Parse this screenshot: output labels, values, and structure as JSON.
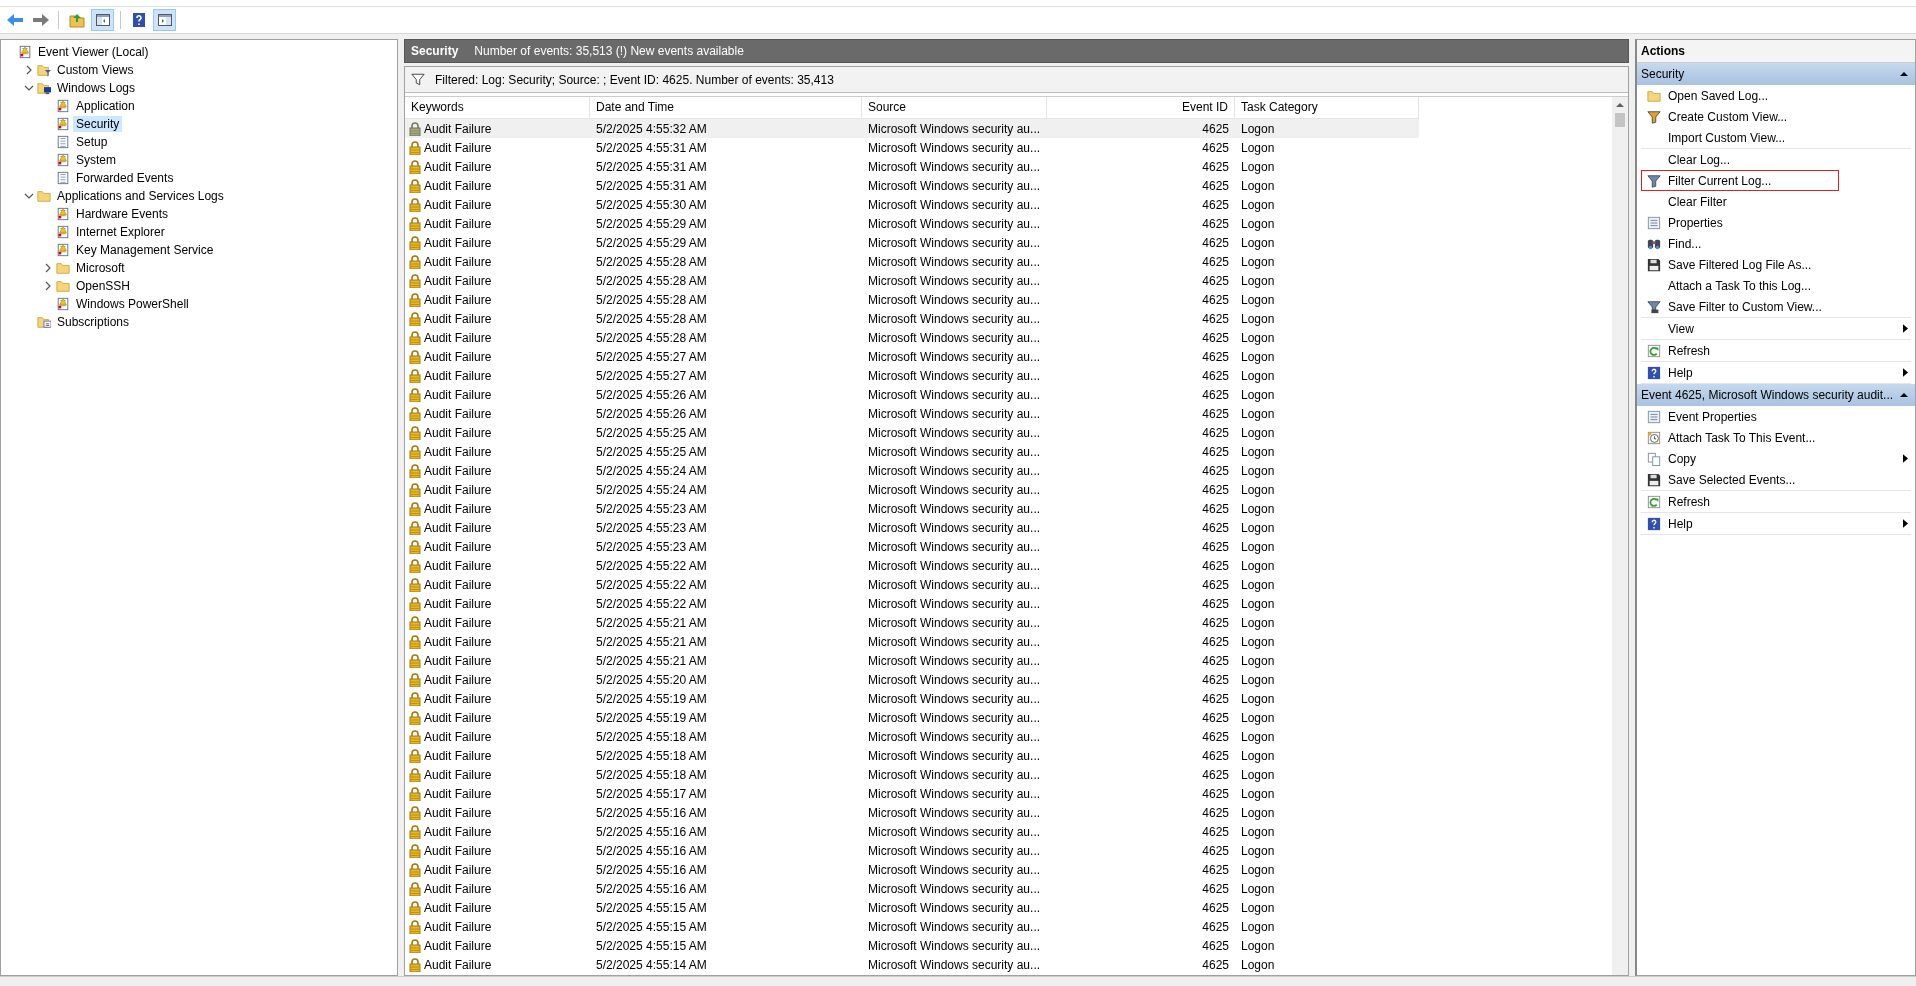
{
  "toolbar": [
    {
      "kind": "back",
      "pressed": false
    },
    {
      "kind": "forward",
      "pressed": false
    },
    {
      "kind": "up",
      "pressed": false
    },
    {
      "kind": "tree",
      "pressed": true
    },
    {
      "kind": "help",
      "pressed": false
    },
    {
      "kind": "pane",
      "pressed": true
    }
  ],
  "tree": [
    {
      "label": "Event Viewer (Local)",
      "kind": "viewer",
      "selected": false,
      "children": [
        {
          "label": "Custom Views",
          "kind": "folder-filter",
          "expanded": false,
          "selected": false
        },
        {
          "label": "Windows Logs",
          "kind": "folder-logs",
          "expanded": true,
          "selected": false,
          "children": [
            {
              "label": "Application",
              "kind": "log",
              "selected": false
            },
            {
              "label": "Security",
              "kind": "log",
              "selected": true
            },
            {
              "label": "Setup",
              "kind": "log-plain",
              "selected": false
            },
            {
              "label": "System",
              "kind": "log",
              "selected": false
            },
            {
              "label": "Forwarded Events",
              "kind": "log-plain",
              "selected": false
            }
          ]
        },
        {
          "label": "Applications and Services Logs",
          "kind": "folder-open",
          "expanded": true,
          "selected": false,
          "children": [
            {
              "label": "Hardware Events",
              "kind": "log",
              "selected": false
            },
            {
              "label": "Internet Explorer",
              "kind": "log",
              "selected": false
            },
            {
              "label": "Key Management Service",
              "kind": "log",
              "selected": false
            },
            {
              "label": "Microsoft",
              "kind": "folder",
              "expanded": false,
              "selected": false
            },
            {
              "label": "OpenSSH",
              "kind": "folder",
              "expanded": false,
              "selected": false
            },
            {
              "label": "Windows PowerShell",
              "kind": "log",
              "selected": false
            }
          ]
        },
        {
          "label": "Subscriptions",
          "kind": "subscriptions",
          "selected": false
        }
      ]
    }
  ],
  "log_header": {
    "title": "Security",
    "info": "Number of events: 35,513 (!) New events available"
  },
  "filter_bar": {
    "text": "Filtered: Log: Security; Source: ; Event ID: 4625. Number of events: 35,413"
  },
  "table": {
    "columns": [
      "Keywords",
      "Date and Time",
      "Source",
      "Event ID",
      "Task Category"
    ],
    "rows": [
      {
        "keywords": "Audit Failure",
        "date": "5/2/2025 4:55:32 AM",
        "source": "Microsoft Windows security au...",
        "event_id": "4625",
        "task_category": "Logon",
        "selected": true
      },
      {
        "keywords": "Audit Failure",
        "date": "5/2/2025 4:55:31 AM",
        "source": "Microsoft Windows security au...",
        "event_id": "4625",
        "task_category": "Logon",
        "selected": false
      },
      {
        "keywords": "Audit Failure",
        "date": "5/2/2025 4:55:31 AM",
        "source": "Microsoft Windows security au...",
        "event_id": "4625",
        "task_category": "Logon",
        "selected": false
      },
      {
        "keywords": "Audit Failure",
        "date": "5/2/2025 4:55:31 AM",
        "source": "Microsoft Windows security au...",
        "event_id": "4625",
        "task_category": "Logon",
        "selected": false
      },
      {
        "keywords": "Audit Failure",
        "date": "5/2/2025 4:55:30 AM",
        "source": "Microsoft Windows security au...",
        "event_id": "4625",
        "task_category": "Logon",
        "selected": false
      },
      {
        "keywords": "Audit Failure",
        "date": "5/2/2025 4:55:29 AM",
        "source": "Microsoft Windows security au...",
        "event_id": "4625",
        "task_category": "Logon",
        "selected": false
      },
      {
        "keywords": "Audit Failure",
        "date": "5/2/2025 4:55:29 AM",
        "source": "Microsoft Windows security au...",
        "event_id": "4625",
        "task_category": "Logon",
        "selected": false
      },
      {
        "keywords": "Audit Failure",
        "date": "5/2/2025 4:55:28 AM",
        "source": "Microsoft Windows security au...",
        "event_id": "4625",
        "task_category": "Logon",
        "selected": false
      },
      {
        "keywords": "Audit Failure",
        "date": "5/2/2025 4:55:28 AM",
        "source": "Microsoft Windows security au...",
        "event_id": "4625",
        "task_category": "Logon",
        "selected": false
      },
      {
        "keywords": "Audit Failure",
        "date": "5/2/2025 4:55:28 AM",
        "source": "Microsoft Windows security au...",
        "event_id": "4625",
        "task_category": "Logon",
        "selected": false
      },
      {
        "keywords": "Audit Failure",
        "date": "5/2/2025 4:55:28 AM",
        "source": "Microsoft Windows security au...",
        "event_id": "4625",
        "task_category": "Logon",
        "selected": false
      },
      {
        "keywords": "Audit Failure",
        "date": "5/2/2025 4:55:28 AM",
        "source": "Microsoft Windows security au...",
        "event_id": "4625",
        "task_category": "Logon",
        "selected": false
      },
      {
        "keywords": "Audit Failure",
        "date": "5/2/2025 4:55:27 AM",
        "source": "Microsoft Windows security au...",
        "event_id": "4625",
        "task_category": "Logon",
        "selected": false
      },
      {
        "keywords": "Audit Failure",
        "date": "5/2/2025 4:55:27 AM",
        "source": "Microsoft Windows security au...",
        "event_id": "4625",
        "task_category": "Logon",
        "selected": false
      },
      {
        "keywords": "Audit Failure",
        "date": "5/2/2025 4:55:26 AM",
        "source": "Microsoft Windows security au...",
        "event_id": "4625",
        "task_category": "Logon",
        "selected": false
      },
      {
        "keywords": "Audit Failure",
        "date": "5/2/2025 4:55:26 AM",
        "source": "Microsoft Windows security au...",
        "event_id": "4625",
        "task_category": "Logon",
        "selected": false
      },
      {
        "keywords": "Audit Failure",
        "date": "5/2/2025 4:55:25 AM",
        "source": "Microsoft Windows security au...",
        "event_id": "4625",
        "task_category": "Logon",
        "selected": false
      },
      {
        "keywords": "Audit Failure",
        "date": "5/2/2025 4:55:25 AM",
        "source": "Microsoft Windows security au...",
        "event_id": "4625",
        "task_category": "Logon",
        "selected": false
      },
      {
        "keywords": "Audit Failure",
        "date": "5/2/2025 4:55:24 AM",
        "source": "Microsoft Windows security au...",
        "event_id": "4625",
        "task_category": "Logon",
        "selected": false
      },
      {
        "keywords": "Audit Failure",
        "date": "5/2/2025 4:55:24 AM",
        "source": "Microsoft Windows security au...",
        "event_id": "4625",
        "task_category": "Logon",
        "selected": false
      },
      {
        "keywords": "Audit Failure",
        "date": "5/2/2025 4:55:23 AM",
        "source": "Microsoft Windows security au...",
        "event_id": "4625",
        "task_category": "Logon",
        "selected": false
      },
      {
        "keywords": "Audit Failure",
        "date": "5/2/2025 4:55:23 AM",
        "source": "Microsoft Windows security au...",
        "event_id": "4625",
        "task_category": "Logon",
        "selected": false
      },
      {
        "keywords": "Audit Failure",
        "date": "5/2/2025 4:55:23 AM",
        "source": "Microsoft Windows security au...",
        "event_id": "4625",
        "task_category": "Logon",
        "selected": false
      },
      {
        "keywords": "Audit Failure",
        "date": "5/2/2025 4:55:22 AM",
        "source": "Microsoft Windows security au...",
        "event_id": "4625",
        "task_category": "Logon",
        "selected": false
      },
      {
        "keywords": "Audit Failure",
        "date": "5/2/2025 4:55:22 AM",
        "source": "Microsoft Windows security au...",
        "event_id": "4625",
        "task_category": "Logon",
        "selected": false
      },
      {
        "keywords": "Audit Failure",
        "date": "5/2/2025 4:55:22 AM",
        "source": "Microsoft Windows security au...",
        "event_id": "4625",
        "task_category": "Logon",
        "selected": false
      },
      {
        "keywords": "Audit Failure",
        "date": "5/2/2025 4:55:21 AM",
        "source": "Microsoft Windows security au...",
        "event_id": "4625",
        "task_category": "Logon",
        "selected": false
      },
      {
        "keywords": "Audit Failure",
        "date": "5/2/2025 4:55:21 AM",
        "source": "Microsoft Windows security au...",
        "event_id": "4625",
        "task_category": "Logon",
        "selected": false
      },
      {
        "keywords": "Audit Failure",
        "date": "5/2/2025 4:55:21 AM",
        "source": "Microsoft Windows security au...",
        "event_id": "4625",
        "task_category": "Logon",
        "selected": false
      },
      {
        "keywords": "Audit Failure",
        "date": "5/2/2025 4:55:20 AM",
        "source": "Microsoft Windows security au...",
        "event_id": "4625",
        "task_category": "Logon",
        "selected": false
      },
      {
        "keywords": "Audit Failure",
        "date": "5/2/2025 4:55:19 AM",
        "source": "Microsoft Windows security au...",
        "event_id": "4625",
        "task_category": "Logon",
        "selected": false
      },
      {
        "keywords": "Audit Failure",
        "date": "5/2/2025 4:55:19 AM",
        "source": "Microsoft Windows security au...",
        "event_id": "4625",
        "task_category": "Logon",
        "selected": false
      },
      {
        "keywords": "Audit Failure",
        "date": "5/2/2025 4:55:18 AM",
        "source": "Microsoft Windows security au...",
        "event_id": "4625",
        "task_category": "Logon",
        "selected": false
      },
      {
        "keywords": "Audit Failure",
        "date": "5/2/2025 4:55:18 AM",
        "source": "Microsoft Windows security au...",
        "event_id": "4625",
        "task_category": "Logon",
        "selected": false
      },
      {
        "keywords": "Audit Failure",
        "date": "5/2/2025 4:55:18 AM",
        "source": "Microsoft Windows security au...",
        "event_id": "4625",
        "task_category": "Logon",
        "selected": false
      },
      {
        "keywords": "Audit Failure",
        "date": "5/2/2025 4:55:17 AM",
        "source": "Microsoft Windows security au...",
        "event_id": "4625",
        "task_category": "Logon",
        "selected": false
      },
      {
        "keywords": "Audit Failure",
        "date": "5/2/2025 4:55:16 AM",
        "source": "Microsoft Windows security au...",
        "event_id": "4625",
        "task_category": "Logon",
        "selected": false
      },
      {
        "keywords": "Audit Failure",
        "date": "5/2/2025 4:55:16 AM",
        "source": "Microsoft Windows security au...",
        "event_id": "4625",
        "task_category": "Logon",
        "selected": false
      },
      {
        "keywords": "Audit Failure",
        "date": "5/2/2025 4:55:16 AM",
        "source": "Microsoft Windows security au...",
        "event_id": "4625",
        "task_category": "Logon",
        "selected": false
      },
      {
        "keywords": "Audit Failure",
        "date": "5/2/2025 4:55:16 AM",
        "source": "Microsoft Windows security au...",
        "event_id": "4625",
        "task_category": "Logon",
        "selected": false
      },
      {
        "keywords": "Audit Failure",
        "date": "5/2/2025 4:55:16 AM",
        "source": "Microsoft Windows security au...",
        "event_id": "4625",
        "task_category": "Logon",
        "selected": false
      },
      {
        "keywords": "Audit Failure",
        "date": "5/2/2025 4:55:15 AM",
        "source": "Microsoft Windows security au...",
        "event_id": "4625",
        "task_category": "Logon",
        "selected": false
      },
      {
        "keywords": "Audit Failure",
        "date": "5/2/2025 4:55:15 AM",
        "source": "Microsoft Windows security au...",
        "event_id": "4625",
        "task_category": "Logon",
        "selected": false
      },
      {
        "keywords": "Audit Failure",
        "date": "5/2/2025 4:55:15 AM",
        "source": "Microsoft Windows security au...",
        "event_id": "4625",
        "task_category": "Logon",
        "selected": false
      },
      {
        "keywords": "Audit Failure",
        "date": "5/2/2025 4:55:14 AM",
        "source": "Microsoft Windows security au...",
        "event_id": "4625",
        "task_category": "Logon",
        "selected": false
      }
    ]
  },
  "actions": {
    "title": "Actions",
    "sections": [
      {
        "title": "Security",
        "expanded": true,
        "groups": [
          [
            {
              "label": "Open Saved Log...",
              "kind": "folder-open",
              "submenu": false,
              "highlighted": false
            },
            {
              "label": "Create Custom View...",
              "kind": "funnel-gold",
              "submenu": false,
              "highlighted": false
            },
            {
              "label": "Import Custom View...",
              "kind": "none",
              "submenu": false,
              "highlighted": false
            }
          ],
          [
            {
              "label": "Clear Log...",
              "kind": "none",
              "submenu": false,
              "highlighted": false
            },
            {
              "label": "Filter Current Log...",
              "kind": "funnel",
              "submenu": false,
              "highlighted": true
            },
            {
              "label": "Clear Filter",
              "kind": "none",
              "submenu": false,
              "highlighted": false
            },
            {
              "label": "Properties",
              "kind": "properties",
              "submenu": false,
              "highlighted": false
            },
            {
              "label": "Find...",
              "kind": "binoculars",
              "submenu": false,
              "highlighted": false
            },
            {
              "label": "Save Filtered Log File As...",
              "kind": "floppy",
              "submenu": false,
              "highlighted": false
            },
            {
              "label": "Attach a Task To this Log...",
              "kind": "none",
              "submenu": false,
              "highlighted": false
            },
            {
              "label": "Save Filter to Custom View...",
              "kind": "funnel-save",
              "submenu": false,
              "highlighted": false
            }
          ],
          [
            {
              "label": "View",
              "kind": "none",
              "submenu": true,
              "highlighted": false
            }
          ],
          [
            {
              "label": "Refresh",
              "kind": "refresh",
              "submenu": false,
              "highlighted": false
            }
          ],
          [
            {
              "label": "Help",
              "kind": "help",
              "submenu": true,
              "highlighted": false
            }
          ]
        ]
      },
      {
        "title": "Event 4625, Microsoft Windows security audit...",
        "expanded": true,
        "groups": [
          [
            {
              "label": "Event Properties",
              "kind": "properties",
              "submenu": false,
              "highlighted": false
            },
            {
              "label": "Attach Task To This Event...",
              "kind": "clock",
              "submenu": false,
              "highlighted": false
            },
            {
              "label": "Copy",
              "kind": "copy",
              "submenu": true,
              "highlighted": false
            },
            {
              "label": "Save Selected Events...",
              "kind": "floppy",
              "submenu": false,
              "highlighted": false
            }
          ],
          [
            {
              "label": "Refresh",
              "kind": "refresh",
              "submenu": false,
              "highlighted": false
            }
          ],
          [
            {
              "label": "Help",
              "kind": "help",
              "submenu": true,
              "highlighted": false
            }
          ]
        ]
      }
    ]
  }
}
